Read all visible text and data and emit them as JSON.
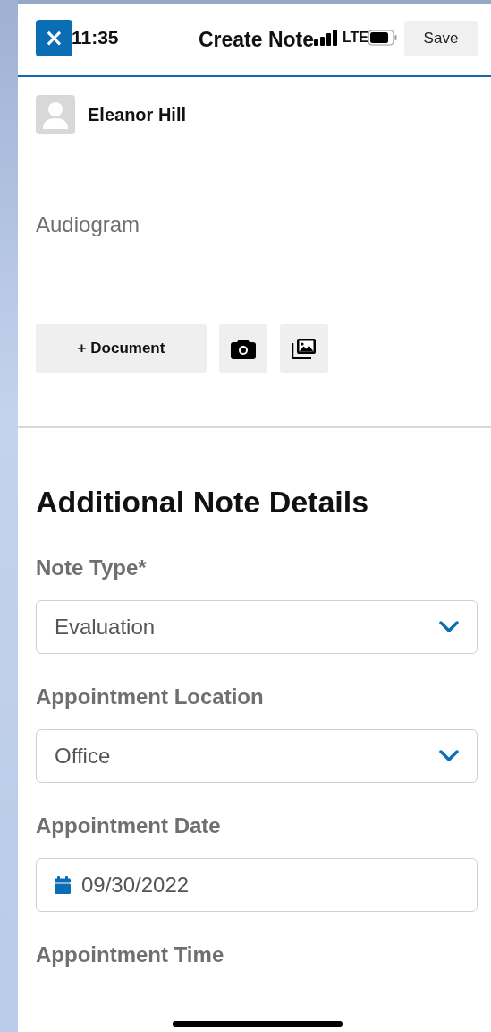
{
  "status_bar": {
    "time": "11:35",
    "network": "LTE"
  },
  "header": {
    "close_label": "×",
    "title": "Create Note",
    "save_label": "Save"
  },
  "contact": {
    "name": "Eleanor Hill"
  },
  "note": {
    "title": "Audiogram"
  },
  "attach_buttons": [
    {
      "kind": "text",
      "label": "+ Document"
    },
    {
      "kind": "camera"
    },
    {
      "kind": "gallery"
    }
  ],
  "section": {
    "heading": "Additional Note Details"
  },
  "fields": [
    {
      "kind": "select",
      "label": "Note Type*",
      "value": "Evaluation"
    },
    {
      "kind": "select",
      "label": "Appointment Location",
      "value": "Office"
    },
    {
      "kind": "date",
      "label": "Appointment Date",
      "value": "09/30/2022"
    },
    {
      "kind": "label",
      "label": "Appointment Time"
    }
  ]
}
